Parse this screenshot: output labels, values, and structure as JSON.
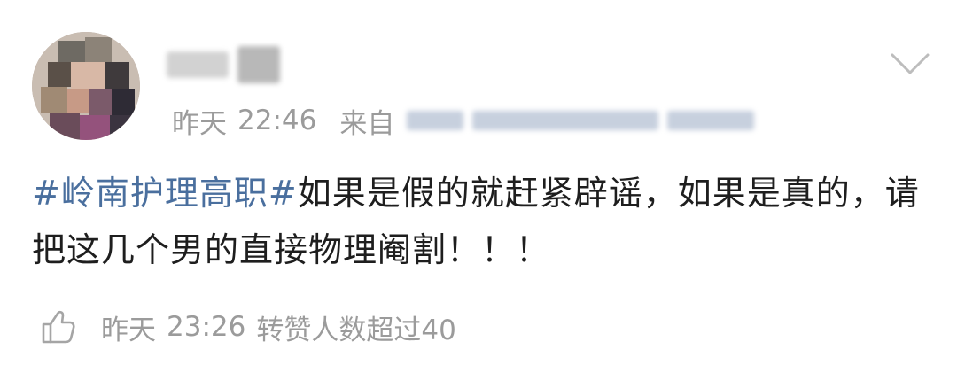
{
  "post": {
    "author": {
      "name": "",
      "avatar_icon": "avatar-image"
    },
    "meta": {
      "date": "昨天",
      "time": "22:46",
      "source_prefix": "来自",
      "source": ""
    },
    "menu_icon": "chevron-down-icon",
    "content": {
      "hashtag": "#岭南护理高职#",
      "text": "如果是假的就赶紧辟谣，如果是真的，请把这几个男的直接物理阉割！！！"
    },
    "footer": {
      "like_icon": "thumbs-up-icon",
      "date": "昨天",
      "time": "23:26",
      "status": "转赞人数超过40"
    }
  },
  "colors": {
    "hashtag": "#4a6f9e",
    "meta_text": "#9b9b9b",
    "body_text": "#1e1e1e",
    "background": "#ffffff"
  }
}
